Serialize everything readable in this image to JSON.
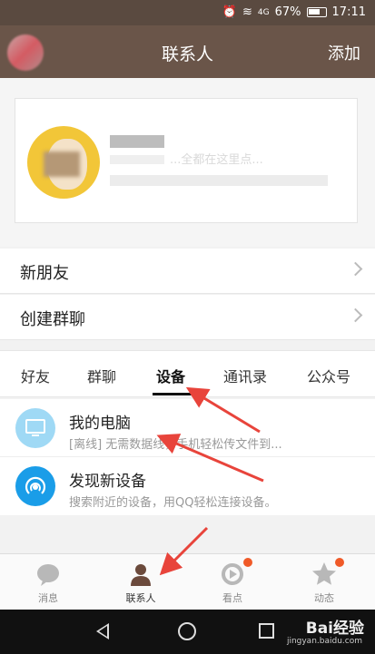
{
  "status_bar": {
    "battery": "67%",
    "time": "17:11",
    "network": "4G"
  },
  "header": {
    "title": "联系人",
    "add_label": "添加"
  },
  "profile": {
    "note": "...全都在这里点..."
  },
  "menu": [
    {
      "label": "新朋友"
    },
    {
      "label": "创建群聊"
    }
  ],
  "tabs": [
    {
      "label": "好友"
    },
    {
      "label": "群聊"
    },
    {
      "label": "设备",
      "active": true
    },
    {
      "label": "通讯录"
    },
    {
      "label": "公众号"
    }
  ],
  "devices": [
    {
      "title": "我的电脑",
      "subtitle": "[离线] 无需数据线，手机轻松传文件到...",
      "icon": "computer-icon",
      "color": "#9fd9f5"
    },
    {
      "title": "发现新设备",
      "subtitle": "搜索附近的设备，用QQ轻松连接设备。",
      "icon": "radar-icon",
      "color": "#1a9de8"
    }
  ],
  "bottom_nav": [
    {
      "label": "消息",
      "icon": "message-icon"
    },
    {
      "label": "联系人",
      "icon": "contacts-icon",
      "active": true
    },
    {
      "label": "看点",
      "icon": "video-icon",
      "badge": true
    },
    {
      "label": "动态",
      "icon": "star-icon",
      "badge": true
    }
  ],
  "watermark": {
    "brand": "Bai经验",
    "url": "jingyan.baidu.com"
  },
  "colors": {
    "header": "#6a5549",
    "accent_red": "#e8443b",
    "badge": "#f05a28"
  }
}
